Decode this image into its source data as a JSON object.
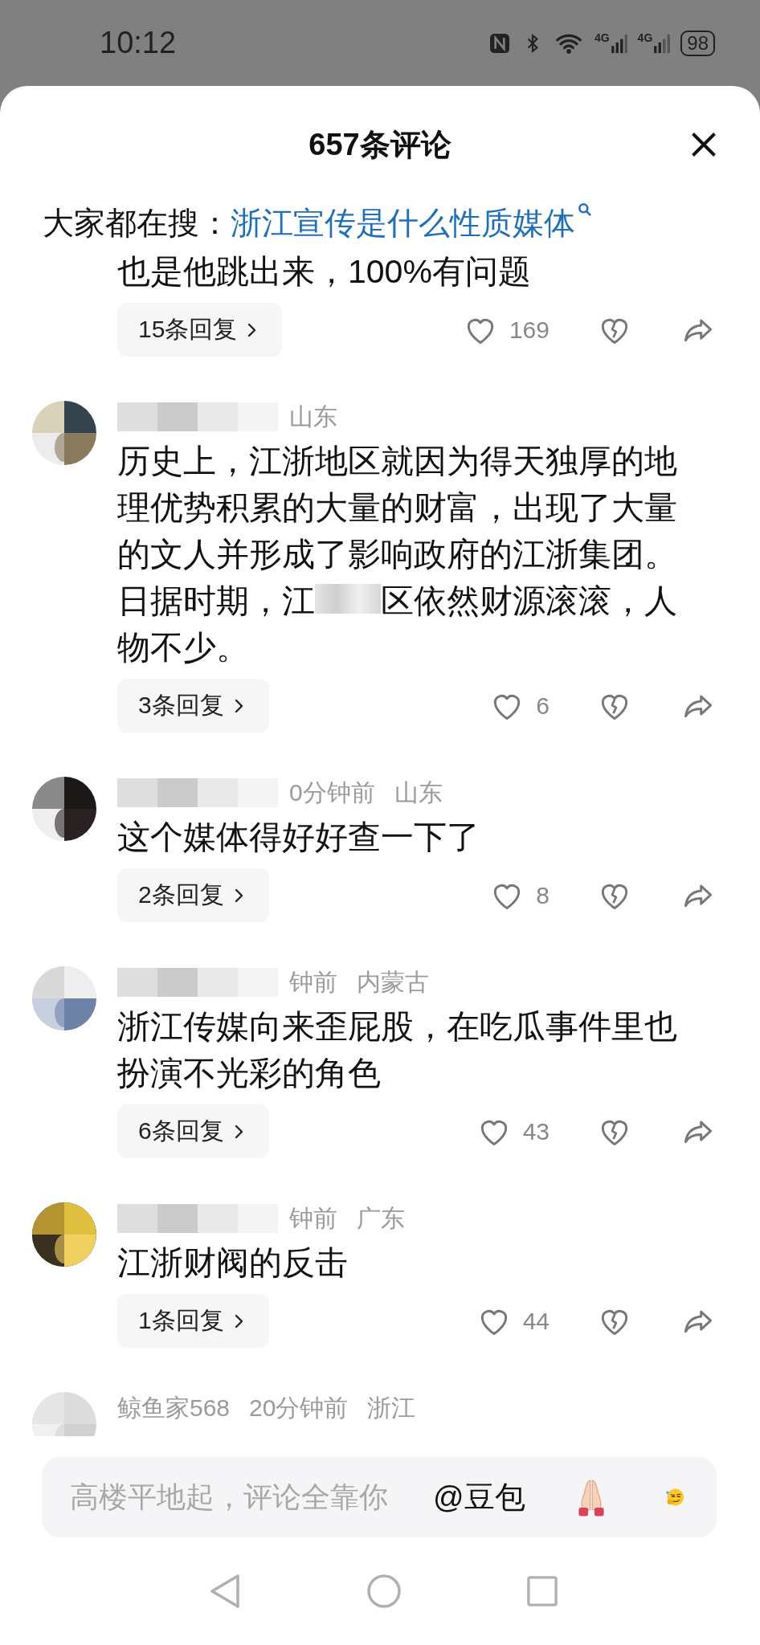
{
  "status_bar": {
    "time": "10:12",
    "network_1": "4G",
    "network_2": "4G",
    "battery": "98"
  },
  "header": {
    "title": "657条评论"
  },
  "trending": {
    "label": "大家都在搜：",
    "query": "浙江宣传是什么性质媒体"
  },
  "comments": [
    {
      "kind": "partial",
      "text_parts": [
        "也是他跳出来，100%有问题"
      ],
      "replies": "15条回复",
      "likes": "169"
    },
    {
      "kind": "full",
      "name_hidden": true,
      "location": "山东",
      "text_parts": [
        "历史上，江浙地区就因为得天独厚的地理优势积累的大量的财富，出现了大量的文人并形成了影响政府的江浙集团。日据时期，江",
        "区依然财源滚滚，人物不少。"
      ],
      "replies": "3条回复",
      "likes": "6"
    },
    {
      "kind": "full",
      "name_hidden": true,
      "time": "0分钟前",
      "location": "山东",
      "text_parts": [
        "这个媒体得好好查一下了"
      ],
      "replies": "2条回复",
      "likes": "8"
    },
    {
      "kind": "full",
      "name_hidden": true,
      "time": "钟前",
      "location": "内蒙古",
      "text_parts": [
        "浙江传媒向来歪屁股，在吃瓜事件里也扮演不光彩的角色"
      ],
      "replies": "6条回复",
      "likes": "43"
    },
    {
      "kind": "full",
      "name_hidden": true,
      "time": "钟前",
      "location": "广东",
      "text_parts": [
        "江浙财阀的反击"
      ],
      "replies": "1条回复",
      "likes": "44"
    },
    {
      "kind": "cut",
      "name_hidden": false,
      "name": "鲸鱼家568",
      "time": "20分钟前",
      "location": "浙江"
    }
  ],
  "input_bar": {
    "placeholder": "高楼平地起，评论全靠你",
    "mention": "@豆包"
  }
}
